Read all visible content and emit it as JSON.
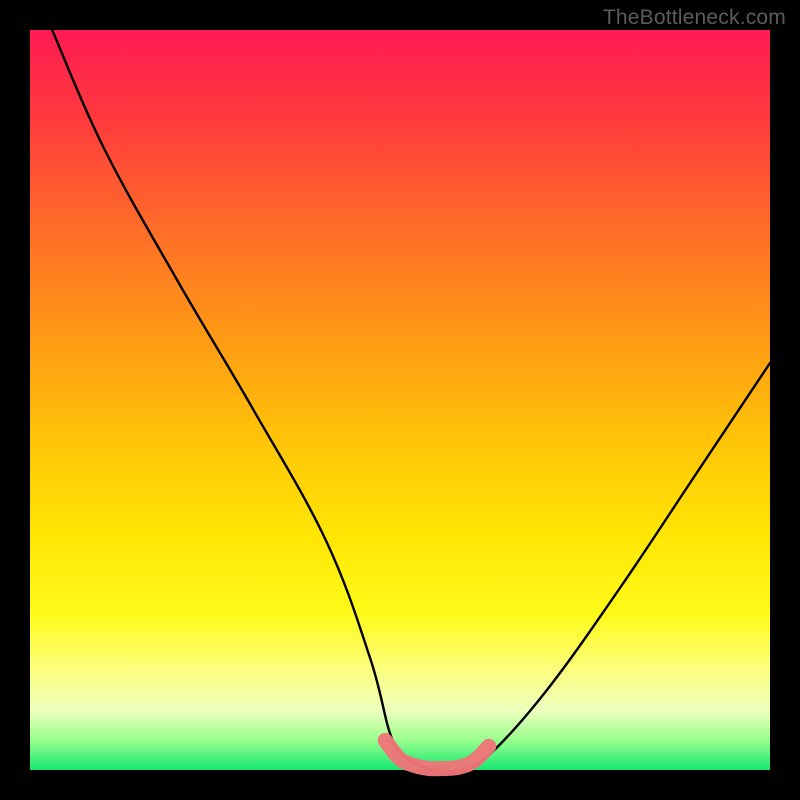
{
  "watermark": "TheBottleneck.com",
  "chart_data": {
    "type": "line",
    "title": "",
    "xlabel": "",
    "ylabel": "",
    "xlim": [
      0,
      100
    ],
    "ylim": [
      0,
      100
    ],
    "grid": false,
    "series": [
      {
        "name": "black-curve",
        "color": "#000000",
        "x": [
          3,
          10,
          20,
          30,
          40,
          46,
          49,
          52,
          55,
          58,
          62,
          70,
          80,
          90,
          100
        ],
        "values": [
          100,
          84,
          66,
          49,
          31,
          15,
          4,
          1,
          0,
          0,
          2,
          11,
          25,
          40,
          55
        ]
      },
      {
        "name": "pink-floor-marker",
        "color": "#ef7579",
        "x": [
          48,
          50,
          52,
          54,
          56,
          58,
          60,
          62
        ],
        "values": [
          4,
          1.5,
          0.6,
          0.2,
          0.2,
          0.4,
          1.2,
          3.2
        ]
      }
    ],
    "background_gradient": {
      "type": "vertical",
      "stops": [
        {
          "pos": 0.0,
          "color": "#ff1a53"
        },
        {
          "pos": 0.12,
          "color": "#ff3a3d"
        },
        {
          "pos": 0.26,
          "color": "#ff6a2a"
        },
        {
          "pos": 0.4,
          "color": "#ff9516"
        },
        {
          "pos": 0.55,
          "color": "#ffc308"
        },
        {
          "pos": 0.68,
          "color": "#ffe504"
        },
        {
          "pos": 0.79,
          "color": "#fffb1a"
        },
        {
          "pos": 0.86,
          "color": "#fdfe78"
        },
        {
          "pos": 0.92,
          "color": "#ecffbd"
        },
        {
          "pos": 0.96,
          "color": "#98fe8d"
        },
        {
          "pos": 1.0,
          "color": "#14e872"
        }
      ]
    }
  }
}
